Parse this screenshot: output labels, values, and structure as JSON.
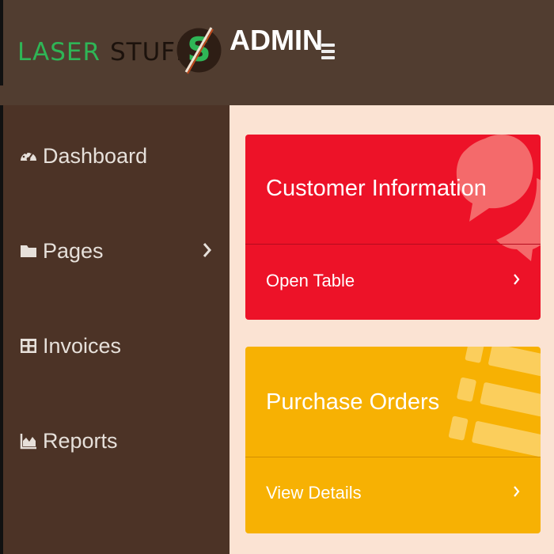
{
  "header": {
    "brand_word_1": "LASER",
    "brand_word_2": "STUFF",
    "title": "ADMIN",
    "logo_icon": "laser-stuff-logo",
    "menu_icon": "hamburger-icon"
  },
  "sidebar": {
    "items": [
      {
        "label": "Dashboard",
        "icon": "dashboard-icon"
      },
      {
        "label": "Pages",
        "icon": "folder-icon",
        "has_submenu": true
      },
      {
        "label": "Invoices",
        "icon": "table-icon"
      },
      {
        "label": "Reports",
        "icon": "area-chart-icon"
      }
    ]
  },
  "cards": [
    {
      "title": "Customer Information",
      "link": "Open Table",
      "color": "#ed1228",
      "icon": "comments-icon"
    },
    {
      "title": "Purchase Orders",
      "link": "View Details",
      "color": "#f7b103",
      "icon": "list-icon"
    }
  ],
  "colors": {
    "header_bg": "#513d30",
    "sidebar_bg": "#4c3326",
    "content_bg": "#fbe3d3",
    "brand_green": "#2fb556"
  }
}
